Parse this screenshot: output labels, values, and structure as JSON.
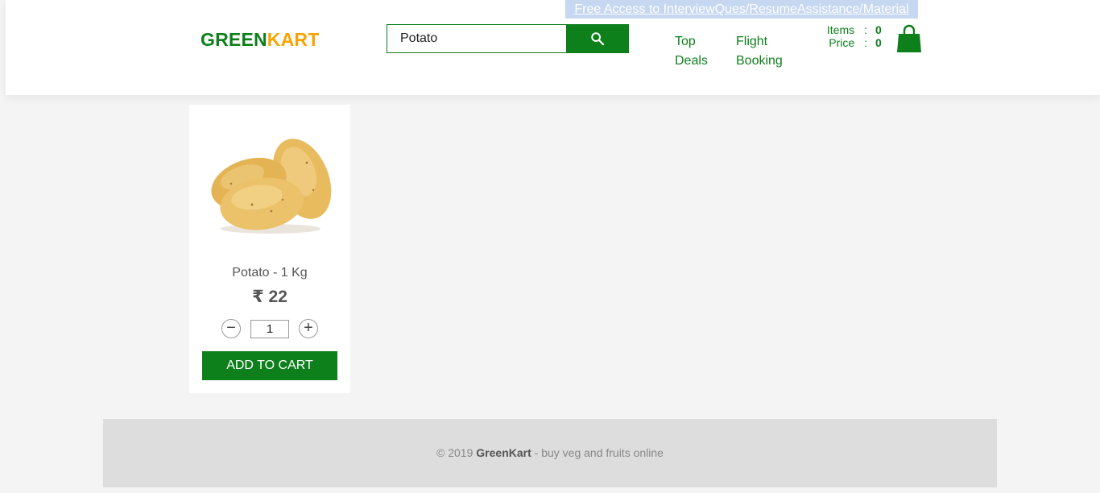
{
  "promo": {
    "text": "Free Access to InterviewQues/ResumeAssistance/Material"
  },
  "brand": {
    "part1": "GREEN",
    "part2": "KART"
  },
  "search": {
    "value": "Potato"
  },
  "nav": {
    "top_deals": [
      "Top",
      "Deals"
    ],
    "flight_booking": [
      "Flight",
      "Booking"
    ]
  },
  "cart": {
    "items_label": "Items",
    "items_value": "0",
    "price_label": "Price",
    "price_value": "0",
    "separator": ":"
  },
  "product": {
    "name": "Potato - 1 Kg",
    "price": "₹ 22",
    "quantity": "1",
    "decrement_symbol": "−",
    "increment_symbol": "+",
    "add_label": "ADD TO CART"
  },
  "footer": {
    "prefix": "© 2019 ",
    "brand": "GreenKart",
    "suffix": " - buy veg and fruits online"
  },
  "colors": {
    "brand_green": "#0d7f1b",
    "brand_orange": "#f7a400",
    "promo_bg": "#c6d7f2"
  },
  "icons": {
    "search": "search-icon",
    "cart": "shopping-bag-icon"
  }
}
